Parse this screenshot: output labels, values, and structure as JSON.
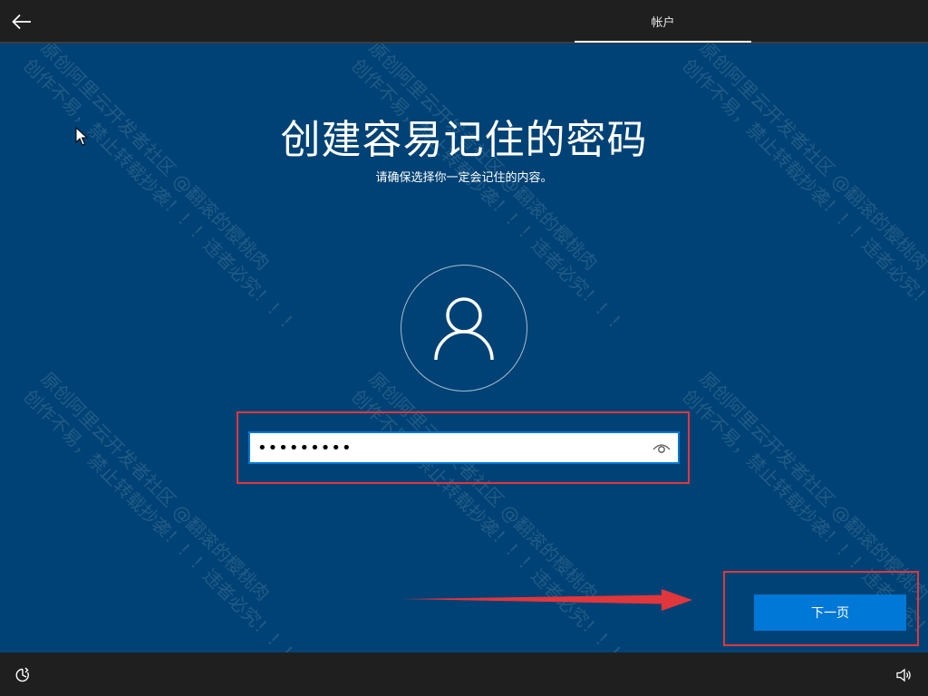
{
  "header": {
    "tab_label": "帐户"
  },
  "main": {
    "title": "创建容易记住的密码",
    "subtitle": "请确保选择你一定会记住的内容。"
  },
  "password": {
    "value": "•••••••••"
  },
  "footer": {
    "next_label": "下一页"
  },
  "watermark": {
    "line1": "原创阿里云开发者社区 @翻滚的樱桃肉",
    "line2": "创作不易，禁止转载抄袭！！！违者必究！！！"
  },
  "icons": {
    "back": "arrow-left-icon",
    "avatar": "user-icon",
    "reveal": "eye-icon",
    "accessibility": "ease-of-access-icon",
    "volume": "volume-icon"
  },
  "colors": {
    "background": "#004275",
    "bar": "#1f1f1f",
    "accent": "#0078d7",
    "annotation": "#e0363c"
  }
}
